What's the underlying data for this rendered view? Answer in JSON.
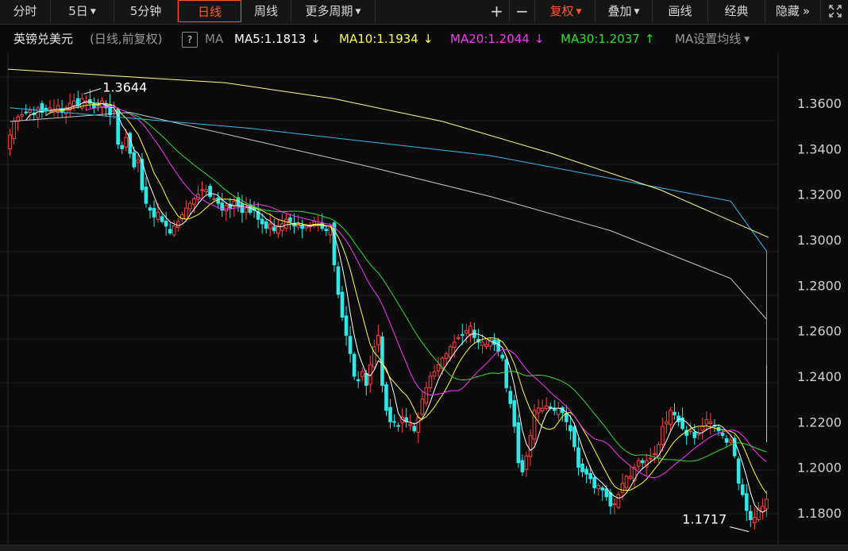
{
  "toolbar": {
    "tabs": [
      {
        "label": "分时",
        "active": false,
        "dropdown": false
      },
      {
        "label": "5日",
        "active": false,
        "dropdown": true
      },
      {
        "label": "5分钟",
        "active": false,
        "dropdown": false
      },
      {
        "label": "日线",
        "active": true,
        "dropdown": false
      },
      {
        "label": "周线",
        "active": false,
        "dropdown": false
      },
      {
        "label": "更多周期",
        "active": false,
        "dropdown": true
      }
    ],
    "zoom_in": "+",
    "zoom_out": "−",
    "right_buttons": [
      {
        "label": "复权",
        "dropdown": true,
        "accent": true
      },
      {
        "label": "叠加",
        "dropdown": true,
        "accent": false
      },
      {
        "label": "画线",
        "dropdown": false,
        "accent": false
      },
      {
        "label": "经典",
        "dropdown": false,
        "accent": false
      },
      {
        "label": "隐藏",
        "dropdown": false,
        "accent": false,
        "suffix": "»"
      }
    ],
    "expand_icon": "expand-icon"
  },
  "infobar": {
    "symbol": "英镑兑美元",
    "mode": "(日线,前复权)",
    "help": "?",
    "ma_label": "MA",
    "ma_values": [
      {
        "name": "MA5",
        "text": "MA5:1.1813",
        "arrow": "↓",
        "color": "#ffffff"
      },
      {
        "name": "MA10",
        "text": "MA10:1.1934",
        "arrow": "↓",
        "color": "#ffff33"
      },
      {
        "name": "MA20",
        "text": "MA20:1.2044",
        "arrow": "↓",
        "color": "#ff33ff"
      },
      {
        "name": "MA30",
        "text": "MA30:1.2037",
        "arrow": "↑",
        "color": "#33dd33"
      }
    ],
    "ma_settings": "MA设置均线"
  },
  "chart_data": {
    "type": "candlestick",
    "y_ticks": [
      "1.3600",
      "1.3400",
      "1.3200",
      "1.3000",
      "1.2800",
      "1.2600",
      "1.2400",
      "1.2200",
      "1.2000",
      "1.1800"
    ],
    "ylim": [
      1.166,
      1.382
    ],
    "grid": true,
    "annotations": [
      {
        "text": "1.3644",
        "value": 1.3644
      },
      {
        "text": "1.1717",
        "value": 1.1717
      }
    ],
    "colors": {
      "up": "#ff4040",
      "down": "#2ee8e8",
      "ma5": "#ffffff",
      "ma10": "#ffff33",
      "ma20": "#ff33ff",
      "ma30": "#33dd33",
      "ma60": "#c8c8c8",
      "ma120": "#33bbee",
      "ma250": "#ffff88"
    },
    "closes": [
      1.346,
      1.352,
      1.354,
      1.355,
      1.356,
      1.357,
      1.355,
      1.358,
      1.356,
      1.357,
      1.358,
      1.357,
      1.359,
      1.356,
      1.358,
      1.36,
      1.361,
      1.359,
      1.362,
      1.361,
      1.36,
      1.358,
      1.359,
      1.361,
      1.358,
      1.355,
      1.357,
      1.342,
      1.34,
      1.345,
      1.338,
      1.332,
      1.335,
      1.322,
      1.316,
      1.313,
      1.31,
      1.312,
      1.308,
      1.306,
      1.303,
      1.306,
      1.308,
      1.311,
      1.314,
      1.316,
      1.318,
      1.32,
      1.322,
      1.322,
      1.319,
      1.318,
      1.316,
      1.313,
      1.315,
      1.314,
      1.317,
      1.315,
      1.312,
      1.314,
      1.312,
      1.313,
      1.309,
      1.307,
      1.305,
      1.307,
      1.304,
      1.306,
      1.307,
      1.309,
      1.308,
      1.306,
      1.307,
      1.305,
      1.306,
      1.306,
      1.308,
      1.307,
      1.305,
      1.304,
      1.306,
      1.289,
      1.276,
      1.266,
      1.258,
      1.25,
      1.24,
      1.238,
      1.242,
      1.236,
      1.245,
      1.253,
      1.258,
      1.236,
      1.225,
      1.22,
      1.22,
      1.218,
      1.222,
      1.22,
      1.219,
      1.216,
      1.222,
      1.23,
      1.235,
      1.24,
      1.242,
      1.245,
      1.248,
      1.25,
      1.253,
      1.255,
      1.257,
      1.258,
      1.26,
      1.262,
      1.257,
      1.255,
      1.255,
      1.254,
      1.256,
      1.254,
      1.251,
      1.248,
      1.235,
      1.228,
      1.218,
      1.202,
      1.198,
      1.205,
      1.214,
      1.225,
      1.226,
      1.226,
      1.227,
      1.226,
      1.225,
      1.226,
      1.224,
      1.22,
      1.216,
      1.209,
      1.2,
      1.198,
      1.197,
      1.195,
      1.191,
      1.192,
      1.19,
      1.187,
      1.183,
      1.184,
      1.188,
      1.193,
      1.196,
      1.196,
      1.2,
      1.203,
      1.202,
      1.203,
      1.204,
      1.206,
      1.21,
      1.218,
      1.22,
      1.225,
      1.223,
      1.22,
      1.217,
      1.214,
      1.216,
      1.213,
      1.215,
      1.218,
      1.221,
      1.22,
      1.218,
      1.216,
      1.214,
      1.211,
      1.212,
      1.205,
      1.193,
      1.188,
      1.181,
      1.177,
      1.178,
      1.182,
      1.183,
      1.186
    ],
    "ma250": [
      [
        1.375,
        1.372
      ],
      [
        1.372,
        1.368
      ],
      [
        1.369,
        1.362
      ],
      [
        1.362,
        1.352
      ],
      [
        1.352,
        1.338
      ],
      [
        1.338,
        1.322
      ],
      [
        1.322,
        1.301
      ]
    ],
    "ma120_points": [
      [
        0,
        1.358
      ],
      [
        60,
        1.349
      ],
      [
        120,
        1.337
      ],
      [
        180,
        1.317
      ],
      [
        240,
        1.295
      ],
      [
        300,
        1.271
      ],
      [
        360,
        1.245
      ]
    ],
    "ma60_points": [
      [
        0,
        1.352
      ],
      [
        30,
        1.356
      ],
      [
        60,
        1.344
      ],
      [
        90,
        1.332
      ],
      [
        120,
        1.319
      ],
      [
        150,
        1.304
      ],
      [
        180,
        1.283
      ],
      [
        210,
        1.265
      ],
      [
        240,
        1.245
      ],
      [
        270,
        1.234
      ],
      [
        300,
        1.226
      ],
      [
        330,
        1.219
      ],
      [
        360,
        1.211
      ]
    ]
  }
}
